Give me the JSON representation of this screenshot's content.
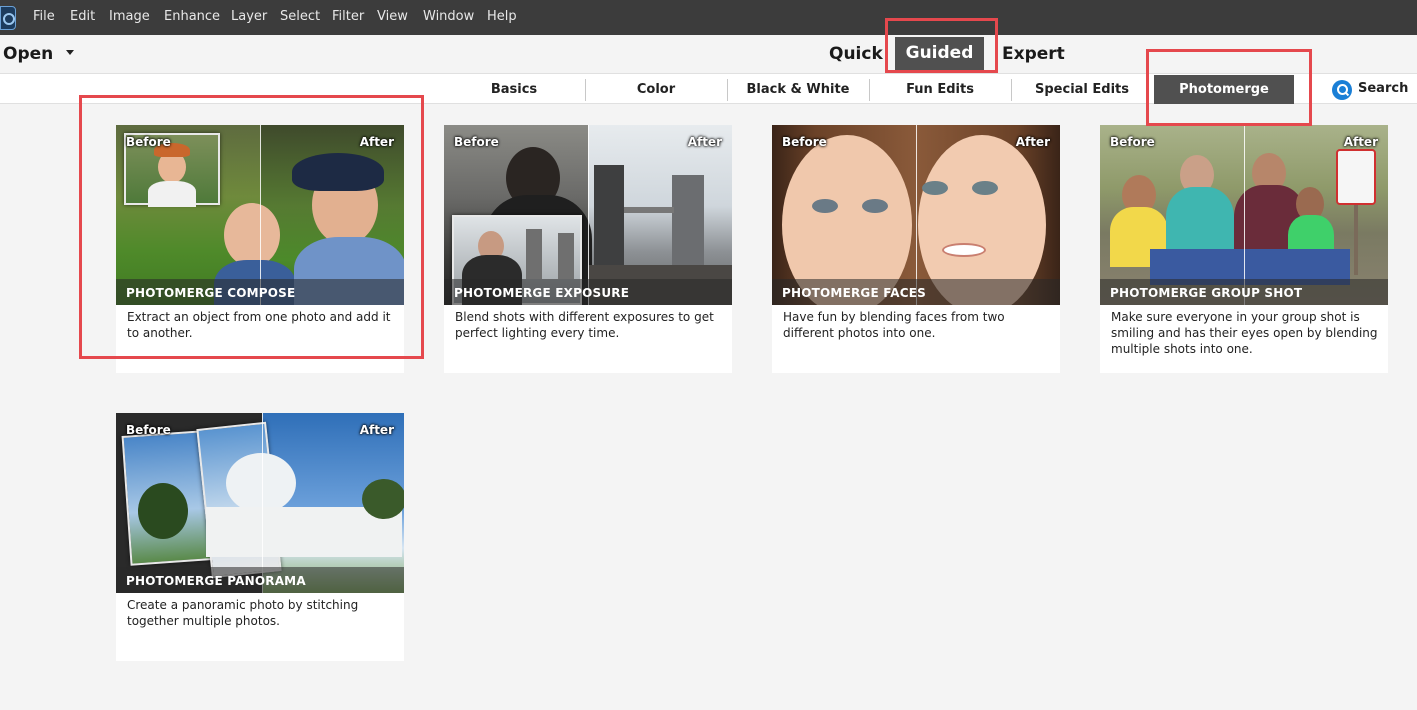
{
  "menubar": {
    "items": [
      "File",
      "Edit",
      "Image",
      "Enhance",
      "Layer",
      "Select",
      "Filter",
      "View",
      "Window",
      "Help"
    ]
  },
  "modebar": {
    "open_label": "Open",
    "modes": [
      "Quick",
      "Guided",
      "Expert"
    ],
    "active_mode": "Guided"
  },
  "tabs": {
    "items": [
      "Basics",
      "Color",
      "Black & White",
      "Fun Edits",
      "Special Edits",
      "Photomerge"
    ],
    "active": "Photomerge",
    "search_label": "Search"
  },
  "cards": [
    {
      "before": "Before",
      "after": "After",
      "title": "PHOTOMERGE COMPOSE",
      "description": "Extract an object from one photo and add it to another."
    },
    {
      "before": "Before",
      "after": "After",
      "title": "PHOTOMERGE EXPOSURE",
      "description": "Blend shots with different exposures to get perfect lighting every time."
    },
    {
      "before": "Before",
      "after": "After",
      "title": "PHOTOMERGE FACES",
      "description": "Have fun by blending faces from two different photos into one."
    },
    {
      "before": "Before",
      "after": "After",
      "title": "PHOTOMERGE GROUP SHOT",
      "description": "Make sure everyone in your group shot is smiling and has their eyes open by blending multiple shots into one."
    },
    {
      "before": "Before",
      "after": "After",
      "title": "PHOTOMERGE PANORAMA",
      "description": "Create a panoramic photo by stitching together multiple photos."
    }
  ],
  "colors": {
    "menubar_bg": "#3c3c3c",
    "active_tab_bg": "#505050",
    "annotation_red": "#e5484d",
    "search_blue": "#1a7fd6"
  }
}
